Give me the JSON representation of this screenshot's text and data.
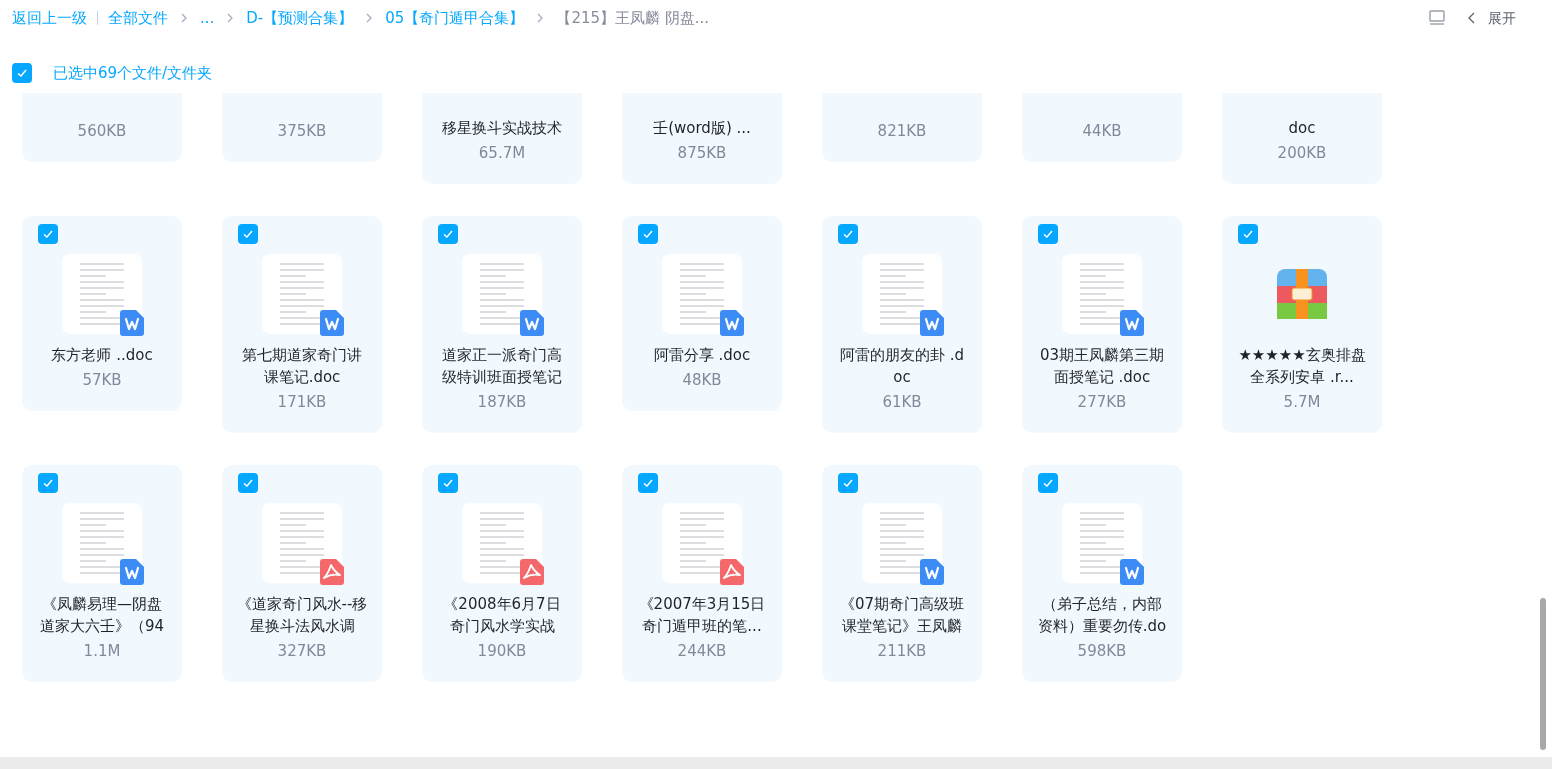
{
  "breadcrumbs": {
    "back": "返回上一级",
    "items": [
      {
        "label": "全部文件",
        "current": false
      },
      {
        "label": "...",
        "current": false
      },
      {
        "label": "D-【预测合集】",
        "current": false
      },
      {
        "label": "05【奇门遁甲合集】",
        "current": false
      },
      {
        "label": "【215】王凤麟 阴盘...",
        "current": true
      }
    ]
  },
  "toolbar": {
    "expand": "展开"
  },
  "selection": {
    "checked": true,
    "label": "已选中69个文件/文件夹"
  },
  "partial_row": [
    {
      "size": "560KB"
    },
    {
      "size": "375KB"
    },
    {
      "name": "移星换斗实战技术",
      "size": "65.7M"
    },
    {
      "name": "壬(word版) ...",
      "size": "875KB"
    },
    {
      "size": "821KB"
    },
    {
      "size": "44KB"
    },
    {
      "name": "doc",
      "size": "200KB"
    }
  ],
  "rows": [
    [
      {
        "kind": "doc",
        "checked": true,
        "name": "东方老师 ..doc",
        "size": "57KB"
      },
      {
        "kind": "doc",
        "checked": true,
        "name": "第七期道家奇门讲课笔记.doc",
        "size": "171KB"
      },
      {
        "kind": "doc",
        "checked": true,
        "name": "道家正一派奇门高级特训班面授笔记",
        "size": "187KB"
      },
      {
        "kind": "doc",
        "checked": true,
        "name": "阿雷分享 .doc",
        "size": "48KB"
      },
      {
        "kind": "doc",
        "checked": true,
        "name": "阿雷的朋友的卦 .doc",
        "size": "61KB"
      },
      {
        "kind": "doc",
        "checked": true,
        "name": "03期王凤麟第三期面授笔记 .doc",
        "size": "277KB"
      },
      {
        "kind": "zip",
        "checked": true,
        "name": "★★★★★玄奥排盘全系列安卓 .r...",
        "size": "5.7M"
      }
    ],
    [
      {
        "kind": "doc",
        "checked": true,
        "name": "《凤麟易理—阴盘道家大六壬》（94",
        "size": "1.1M"
      },
      {
        "kind": "pdf",
        "checked": true,
        "name": "《道家奇门风水--移星换斗法风水调",
        "size": "327KB"
      },
      {
        "kind": "pdf",
        "checked": true,
        "name": "《2008年6月7日奇门风水学实战",
        "size": "190KB"
      },
      {
        "kind": "pdf",
        "checked": true,
        "name": "《2007年3月15日奇门遁甲班的笔...",
        "size": "244KB"
      },
      {
        "kind": "doc",
        "checked": true,
        "name": "《07期奇门高级班课堂笔记》王凤麟",
        "size": "211KB"
      },
      {
        "kind": "doc",
        "checked": true,
        "name": "（弟子总结，内部资料）重要勿传.do",
        "size": "598KB"
      }
    ]
  ]
}
